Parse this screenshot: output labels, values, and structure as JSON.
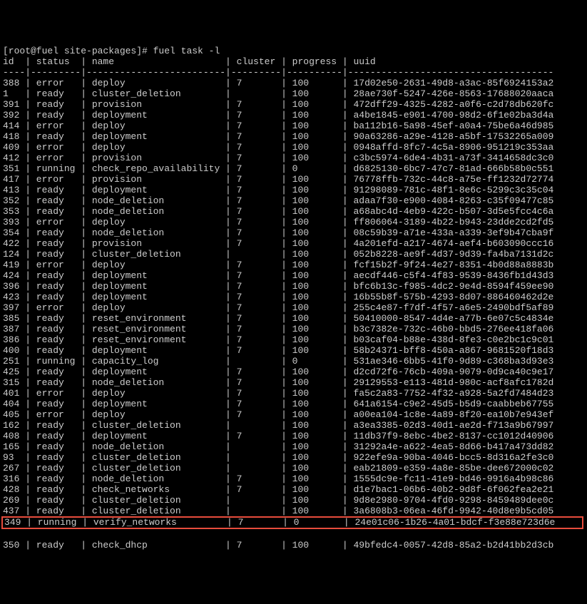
{
  "prompt": "[root@fuel site-packages]# fuel task -l",
  "headers": {
    "id": "id",
    "status": "status",
    "name": "name",
    "cluster": "cluster",
    "progress": "progress",
    "uuid": "uuid"
  },
  "divider": "----|---------|-------------------------|---------|----------|-------------------------------------",
  "rows": [
    {
      "id": "388",
      "status": "error",
      "name": "deploy",
      "cluster": "7",
      "progress": "100",
      "uuid": "17d02e50-2631-49d8-a3ac-85f6924153a2"
    },
    {
      "id": "1",
      "status": "ready",
      "name": "cluster_deletion",
      "cluster": "",
      "progress": "100",
      "uuid": "28ae730f-5247-426e-8563-17688020aaca"
    },
    {
      "id": "391",
      "status": "ready",
      "name": "provision",
      "cluster": "7",
      "progress": "100",
      "uuid": "472dff29-4325-4282-a0f6-c2d78db620fc"
    },
    {
      "id": "392",
      "status": "ready",
      "name": "deployment",
      "cluster": "7",
      "progress": "100",
      "uuid": "a4be1845-e901-4700-98d2-6f1e02ba3d4a"
    },
    {
      "id": "414",
      "status": "error",
      "name": "deploy",
      "cluster": "7",
      "progress": "100",
      "uuid": "ba112b16-5a98-45ef-a0a4-75be6a46d985"
    },
    {
      "id": "418",
      "status": "ready",
      "name": "deployment",
      "cluster": "7",
      "progress": "100",
      "uuid": "90a63286-a29e-4128-a5bf-17532265a009"
    },
    {
      "id": "409",
      "status": "error",
      "name": "deploy",
      "cluster": "7",
      "progress": "100",
      "uuid": "0948affd-8fc7-4c5a-8906-951219c353aa"
    },
    {
      "id": "412",
      "status": "error",
      "name": "provision",
      "cluster": "7",
      "progress": "100",
      "uuid": "c3bc5974-6de4-4b31-a73f-3414658dc3c0"
    },
    {
      "id": "351",
      "status": "running",
      "name": "check_repo_availability",
      "cluster": "7",
      "progress": "0",
      "uuid": "d6825130-6bc7-47c7-81ad-666b58b0c551"
    },
    {
      "id": "417",
      "status": "error",
      "name": "provision",
      "cluster": "7",
      "progress": "100",
      "uuid": "76778ffb-732c-44c8-a75e-ff1232d72774"
    },
    {
      "id": "413",
      "status": "ready",
      "name": "deployment",
      "cluster": "7",
      "progress": "100",
      "uuid": "91298089-781c-48f1-8e6c-5299c3c35c04"
    },
    {
      "id": "352",
      "status": "ready",
      "name": "node_deletion",
      "cluster": "7",
      "progress": "100",
      "uuid": "adaa7f30-e900-4084-8263-c35f09477c85"
    },
    {
      "id": "353",
      "status": "ready",
      "name": "node_deletion",
      "cluster": "7",
      "progress": "100",
      "uuid": "a68abc4d-4eb9-422c-b507-3d5e5fcc4c6a"
    },
    {
      "id": "393",
      "status": "error",
      "name": "deploy",
      "cluster": "7",
      "progress": "100",
      "uuid": "ff806064-3189-4b22-b943-23dde2cd2fd5"
    },
    {
      "id": "354",
      "status": "ready",
      "name": "node_deletion",
      "cluster": "7",
      "progress": "100",
      "uuid": "08c59b39-a71e-433a-a339-3ef9b47cba9f"
    },
    {
      "id": "422",
      "status": "ready",
      "name": "provision",
      "cluster": "7",
      "progress": "100",
      "uuid": "4a201efd-a217-4674-aef4-b603090ccc16"
    },
    {
      "id": "124",
      "status": "ready",
      "name": "cluster_deletion",
      "cluster": "",
      "progress": "100",
      "uuid": "052b8228-ae9f-4d37-9d39-fa4ba7131d2c"
    },
    {
      "id": "419",
      "status": "error",
      "name": "deploy",
      "cluster": "7",
      "progress": "100",
      "uuid": "fcf15b2f-9f24-4e27-8351-4b0d88a8883b"
    },
    {
      "id": "424",
      "status": "ready",
      "name": "deployment",
      "cluster": "7",
      "progress": "100",
      "uuid": "aecdf446-c5f4-4f83-9539-8436fb1d43d3"
    },
    {
      "id": "396",
      "status": "ready",
      "name": "deployment",
      "cluster": "7",
      "progress": "100",
      "uuid": "bfc6b13c-f985-4dc2-9e4d-8594f459ee90"
    },
    {
      "id": "423",
      "status": "ready",
      "name": "deployment",
      "cluster": "7",
      "progress": "100",
      "uuid": "16b55b8f-575b-4293-8d07-886460462d2e"
    },
    {
      "id": "397",
      "status": "error",
      "name": "deploy",
      "cluster": "7",
      "progress": "100",
      "uuid": "255c4e87-f7df-4f57-a6e5-2490bdf5af89"
    },
    {
      "id": "385",
      "status": "ready",
      "name": "reset_environment",
      "cluster": "7",
      "progress": "100",
      "uuid": "50410000-8547-4d4e-a77b-6e07c5c4834e"
    },
    {
      "id": "387",
      "status": "ready",
      "name": "reset_environment",
      "cluster": "7",
      "progress": "100",
      "uuid": "b3c7382e-732c-46b0-bbd5-276ee418fa06"
    },
    {
      "id": "386",
      "status": "ready",
      "name": "reset_environment",
      "cluster": "7",
      "progress": "100",
      "uuid": "b03caf04-b88e-438d-8fe3-c0e2bc1c9c01"
    },
    {
      "id": "400",
      "status": "ready",
      "name": "deployment",
      "cluster": "7",
      "progress": "100",
      "uuid": "58b24371-bff8-450a-a867-9681520f18d3"
    },
    {
      "id": "251",
      "status": "running",
      "name": "capacity_log",
      "cluster": "",
      "progress": "0",
      "uuid": "531ae346-6bb5-41f0-9d89-c368ba3d93e3"
    },
    {
      "id": "425",
      "status": "ready",
      "name": "deployment",
      "cluster": "7",
      "progress": "100",
      "uuid": "d2cd72f6-76cb-409a-9079-0d9ca40c9e17"
    },
    {
      "id": "315",
      "status": "ready",
      "name": "node_deletion",
      "cluster": "7",
      "progress": "100",
      "uuid": "29129553-e113-481d-980c-acf8afc1782d"
    },
    {
      "id": "401",
      "status": "error",
      "name": "deploy",
      "cluster": "7",
      "progress": "100",
      "uuid": "fa5c2a83-7752-4f32-a928-5a2fd7484d23"
    },
    {
      "id": "404",
      "status": "ready",
      "name": "deployment",
      "cluster": "7",
      "progress": "100",
      "uuid": "641a6154-c9e2-45d5-b5d9-caabbeb67755"
    },
    {
      "id": "405",
      "status": "error",
      "name": "deploy",
      "cluster": "7",
      "progress": "100",
      "uuid": "a00ea104-1c8e-4a89-8f20-ea10b7e943ef"
    },
    {
      "id": "162",
      "status": "ready",
      "name": "cluster_deletion",
      "cluster": "",
      "progress": "100",
      "uuid": "a3ea3385-02d3-40d1-ae2d-f713a9b67997"
    },
    {
      "id": "408",
      "status": "ready",
      "name": "deployment",
      "cluster": "7",
      "progress": "100",
      "uuid": "11db37f9-8ebc-4be2-8137-cc1012d40906"
    },
    {
      "id": "165",
      "status": "ready",
      "name": "node_deletion",
      "cluster": "",
      "progress": "100",
      "uuid": "31292a4e-a622-4ea5-8d66-b417a473dd82"
    },
    {
      "id": "93",
      "status": "ready",
      "name": "cluster_deletion",
      "cluster": "",
      "progress": "100",
      "uuid": "922efe9a-90ba-4046-bcc5-8d316a2fe3c0"
    },
    {
      "id": "267",
      "status": "ready",
      "name": "cluster_deletion",
      "cluster": "",
      "progress": "100",
      "uuid": "eab21809-e359-4a8e-85be-dee672000c02"
    },
    {
      "id": "316",
      "status": "ready",
      "name": "node_deletion",
      "cluster": "7",
      "progress": "100",
      "uuid": "1555dc9e-fc11-41e9-bd46-9916a4b98c86"
    },
    {
      "id": "428",
      "status": "ready",
      "name": "check_networks",
      "cluster": "7",
      "progress": "100",
      "uuid": "d1e7bac1-06b6-40b2-9d8f-6f062fea2e21"
    },
    {
      "id": "269",
      "status": "ready",
      "name": "cluster_deletion",
      "cluster": "",
      "progress": "100",
      "uuid": "9d8e2980-9704-4fd0-9298-8459489dee0c"
    },
    {
      "id": "437",
      "status": "ready",
      "name": "cluster_deletion",
      "cluster": "",
      "progress": "100",
      "uuid": "3a6808b3-06ea-46fd-9942-40d8e9b5cd05"
    },
    {
      "id": "349",
      "status": "running",
      "name": "verify_networks",
      "cluster": "7",
      "progress": "0",
      "uuid": "24e01c06-1b26-4a01-bdcf-f3e88e723d6e",
      "highlighted": true
    },
    {
      "id": "350",
      "status": "ready",
      "name": "check_dhcp",
      "cluster": "7",
      "progress": "100",
      "uuid": "49bfedc4-0057-42d8-85a2-b2d41bb2d3cb"
    }
  ]
}
